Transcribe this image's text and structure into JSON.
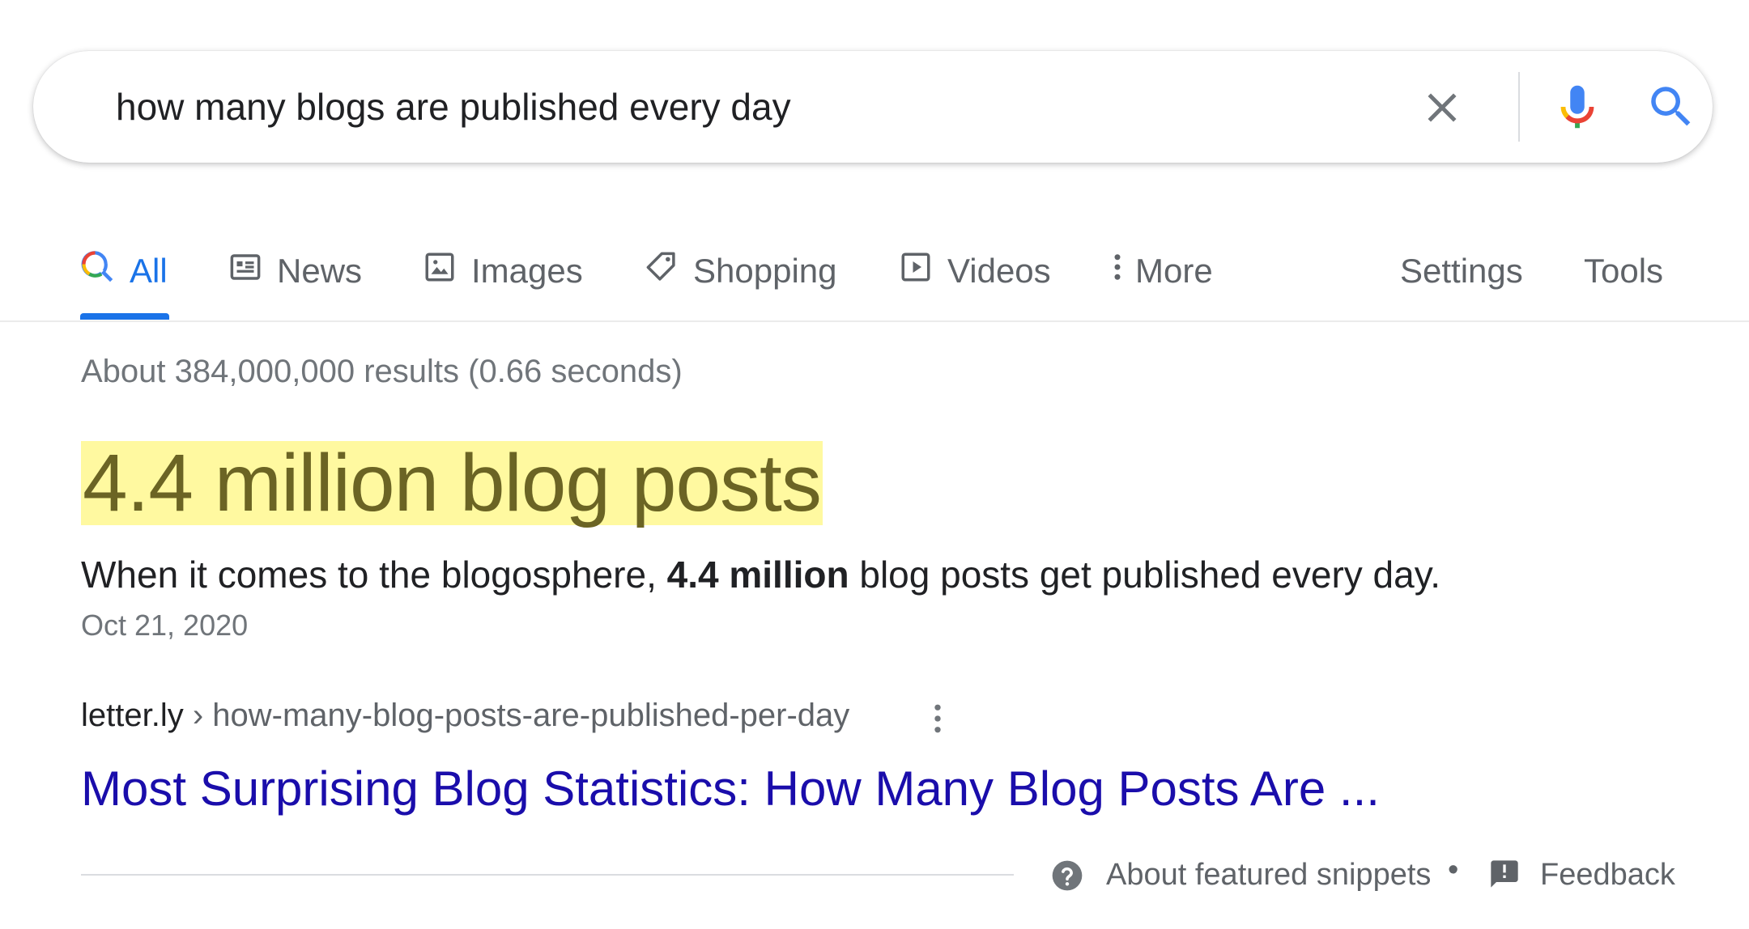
{
  "search": {
    "query": "how many blogs are published every day",
    "clear_icon": "close-icon",
    "mic_icon": "microphone-icon",
    "search_icon": "search-icon"
  },
  "tabs": [
    {
      "label": "All",
      "icon": "search-icon",
      "active": true
    },
    {
      "label": "News",
      "icon": "news-icon"
    },
    {
      "label": "Images",
      "icon": "image-icon"
    },
    {
      "label": "Shopping",
      "icon": "tag-icon"
    },
    {
      "label": "Videos",
      "icon": "video-icon"
    },
    {
      "label": "More",
      "icon": "more-vert-icon"
    },
    {
      "label": "Settings"
    },
    {
      "label": "Tools"
    }
  ],
  "result_stats": "About 384,000,000 results (0.66 seconds)",
  "featured": {
    "answer": "4.4 million blog posts",
    "snippet_before": "When it comes to the blogosphere, ",
    "snippet_bold": "4.4 million",
    "snippet_after": " blog posts get published every day.",
    "date": "Oct 21, 2020",
    "site": "letter.ly",
    "path": " › how-many-blog-posts-are-published-per-day",
    "title": "Most Surprising Blog Statistics: How Many Blog Posts Are ..."
  },
  "footer": {
    "about": "About featured snippets",
    "separator": "•",
    "feedback": "Feedback"
  },
  "colors": {
    "link": "#1a0dab",
    "accent": "#1a73e8",
    "highlight": "#fff9a0",
    "answer_text": "#6b6424"
  }
}
